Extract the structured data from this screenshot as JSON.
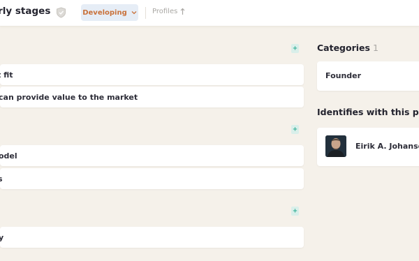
{
  "header": {
    "title": "arly stages",
    "status_label": "Developing",
    "profiles_label": "Profiles"
  },
  "sections": [
    {
      "rows": [
        {
          "label": "t fit"
        },
        {
          "label": "can provide value to the market"
        }
      ]
    },
    {
      "rows": [
        {
          "label": "odel"
        },
        {
          "label": "s"
        }
      ]
    },
    {
      "rows": [
        {
          "label": "y"
        }
      ]
    }
  ],
  "plus_label": "+",
  "sidebar": {
    "categories_heading": "Categories",
    "categories_count": "1",
    "category_item": "Founder",
    "identifies_heading": "Identifies with this profil",
    "person_name": "Eirik A. Johansen"
  },
  "colors": {
    "accent_teal": "#3db39a",
    "status_orange": "#c9713a",
    "status_bg": "#e6edf6",
    "page_bg": "#f5f1ea"
  },
  "icons": {
    "shield": "shield-icon",
    "chevron": "chevron-down-icon",
    "external": "arrow-up-icon",
    "plus": "plus-icon"
  }
}
